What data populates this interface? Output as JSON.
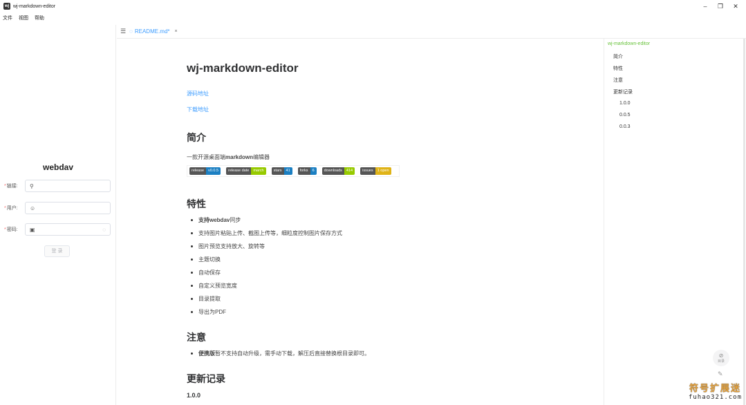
{
  "window": {
    "title": "wj-markdown-editor",
    "icon_text": "wj",
    "controls": {
      "minimize": "–",
      "maximize": "❐",
      "close": "✕"
    }
  },
  "menu": [
    "文件",
    "视图",
    "帮助"
  ],
  "login": {
    "title": "webdav",
    "fields": [
      {
        "label": "链接:",
        "icon": "link-icon",
        "glyph": "🔗"
      },
      {
        "label": "用户:",
        "icon": "user-icon",
        "glyph": "👤"
      },
      {
        "label": "密码:",
        "icon": "lock-icon",
        "glyph": "🔒"
      }
    ],
    "required_mark": "*",
    "submit": "登 录"
  },
  "tab": {
    "name": "README.md*",
    "close": "×"
  },
  "doc": {
    "title": "wj-markdown-editor",
    "links": [
      "源码地址",
      "下载地址"
    ],
    "intro_heading": "简介",
    "intro_text_prefix": "一款开源桌面端",
    "intro_text_bold": "markdown",
    "intro_text_suffix": "编辑器",
    "badges": [
      {
        "label": "release",
        "value": "v0.0.5",
        "color": "#1b7fc2"
      },
      {
        "label": "release date",
        "value": "march",
        "color": "#97ca00"
      },
      {
        "label": "stars",
        "value": "41",
        "color": "#1b7fc2"
      },
      {
        "label": "forks",
        "value": "6",
        "color": "#1b7fc2"
      },
      {
        "label": "downloads",
        "value": "414",
        "color": "#97ca00"
      },
      {
        "label": "issues",
        "value": "1 open",
        "color": "#dfb317"
      }
    ],
    "features_heading": "特性",
    "features": [
      {
        "bold": "支持webdav",
        "text": "同步"
      },
      {
        "bold": "",
        "text": "支持图片粘贴上传、截图上传等，细粒度控制图片保存方式"
      },
      {
        "bold": "",
        "text": "图片预览支持放大、旋转等"
      },
      {
        "bold": "",
        "text": "主题切换"
      },
      {
        "bold": "",
        "text": "自动保存"
      },
      {
        "bold": "",
        "text": "自定义预览宽度"
      },
      {
        "bold": "",
        "text": "目录提取"
      },
      {
        "bold": "",
        "text": "导出为PDF"
      }
    ],
    "notes_heading": "注意",
    "notes": [
      {
        "bold": "便携版",
        "text": "暂不支持自动升级，需手动下载，解压后直接替换根目录即可。"
      }
    ],
    "changelog_heading": "更新记录",
    "changelog_first": "1.0.0"
  },
  "outline": {
    "root": "wj-markdown-editor",
    "items": [
      "简介",
      "特性",
      "注意",
      "更新记录"
    ],
    "sub_items": [
      "1.0.0",
      "0.0.5",
      "0.0.3"
    ]
  },
  "float_button": {
    "icon": "eye-off-icon",
    "label": "目录"
  },
  "watermark": {
    "cn": "符号扩展迷",
    "en": "fuhao321.com"
  }
}
